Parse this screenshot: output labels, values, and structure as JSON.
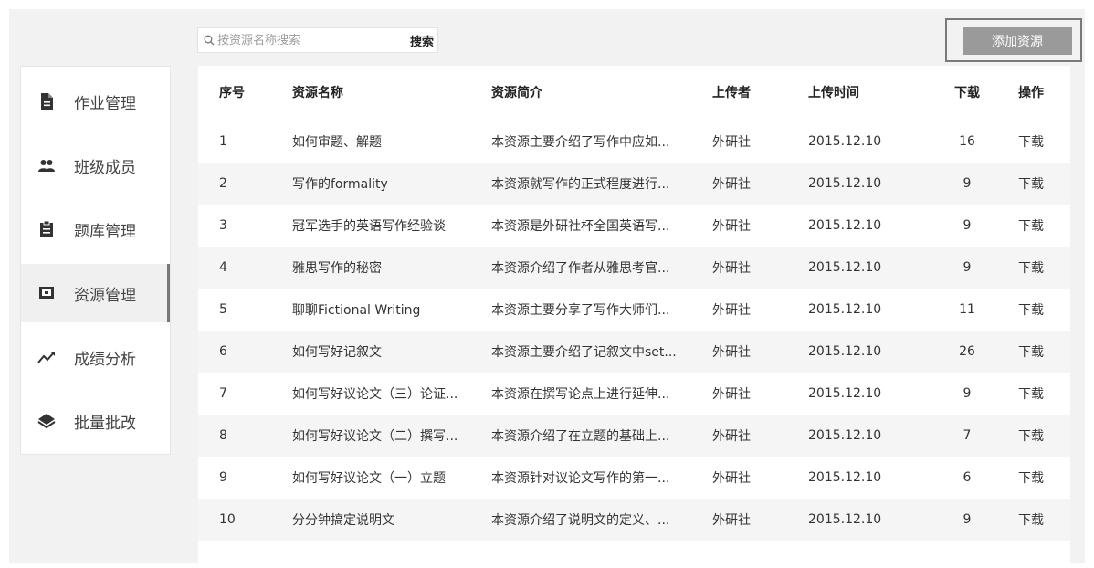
{
  "search": {
    "placeholder": "按资源名称搜索",
    "button_label": "搜索"
  },
  "toolbar": {
    "add_label": "添加资源"
  },
  "sidebar": {
    "items": [
      {
        "label": "作业管理",
        "icon": "document-icon"
      },
      {
        "label": "班级成员",
        "icon": "users-icon"
      },
      {
        "label": "题库管理",
        "icon": "clipboard-icon"
      },
      {
        "label": "资源管理",
        "icon": "monitor-icon",
        "active": true
      },
      {
        "label": "成绩分析",
        "icon": "trend-icon"
      },
      {
        "label": "批量批改",
        "icon": "layers-icon"
      }
    ]
  },
  "table": {
    "headers": {
      "index": "序号",
      "name": "资源名称",
      "desc": "资源简介",
      "uploader": "上传者",
      "time": "上传时间",
      "downloads": "下载",
      "action": "操作"
    },
    "rows": [
      {
        "index": "1",
        "name": "如何审题、解题",
        "desc": "本资源主要介绍了写作中应如...",
        "uploader": "外研社",
        "time": "2015.12.10",
        "downloads": "16",
        "action": "下载"
      },
      {
        "index": "2",
        "name": "写作的formality",
        "desc": "本资源就写作的正式程度进行...",
        "uploader": "外研社",
        "time": "2015.12.10",
        "downloads": "9",
        "action": "下载"
      },
      {
        "index": "3",
        "name": "冠军选手的英语写作经验谈",
        "desc": "本资源是外研社杯全国英语写...",
        "uploader": "外研社",
        "time": "2015.12.10",
        "downloads": "9",
        "action": "下载"
      },
      {
        "index": "4",
        "name": "雅思写作的秘密",
        "desc": "本资源介绍了作者从雅思考官...",
        "uploader": "外研社",
        "time": "2015.12.10",
        "downloads": "9",
        "action": "下载"
      },
      {
        "index": "5",
        "name": "聊聊Fictional Writing",
        "desc": "本资源主要分享了写作大师们...",
        "uploader": "外研社",
        "time": "2015.12.10",
        "downloads": "11",
        "action": "下载"
      },
      {
        "index": "6",
        "name": "如何写好记叙文",
        "desc": "本资源主要介绍了记叙文中set...",
        "uploader": "外研社",
        "time": "2015.12.10",
        "downloads": "26",
        "action": "下载"
      },
      {
        "index": "7",
        "name": "如何写好议论文（三）论证...",
        "desc": "本资源在撰写论点上进行延伸...",
        "uploader": "外研社",
        "time": "2015.12.10",
        "downloads": "9",
        "action": "下载"
      },
      {
        "index": "8",
        "name": "如何写好议论文（二）撰写...",
        "desc": "本资源介绍了在立题的基础上...",
        "uploader": "外研社",
        "time": "2015.12.10",
        "downloads": "7",
        "action": "下载"
      },
      {
        "index": "9",
        "name": "如何写好议论文（一）立题",
        "desc": "本资源针对议论文写作的第一...",
        "uploader": "外研社",
        "time": "2015.12.10",
        "downloads": "6",
        "action": "下载"
      },
      {
        "index": "10",
        "name": "分分钟搞定说明文",
        "desc": "本资源介绍了说明文的定义、...",
        "uploader": "外研社",
        "time": "2015.12.10",
        "downloads": "9",
        "action": "下载"
      }
    ]
  }
}
